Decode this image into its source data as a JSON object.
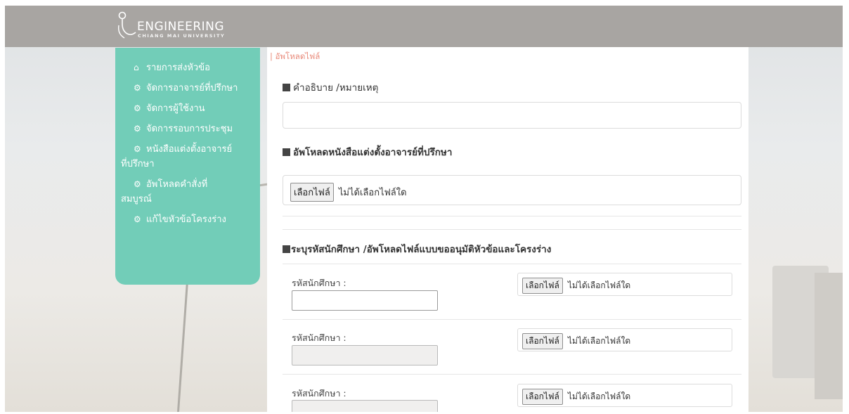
{
  "header": {
    "logo_title": "ENGINEERING",
    "logo_subtitle": "CHIANG MAI UNIVERSITY"
  },
  "sidebar": {
    "items": [
      {
        "icon": "home-icon",
        "label": "รายการส่งหัวข้อ"
      },
      {
        "icon": "gear-icon",
        "label": "จัดการอาจารย์ที่ปรึกษา"
      },
      {
        "icon": "gear-icon",
        "label": "จัดการผู้ใช้งาน"
      },
      {
        "icon": "gear-icon",
        "label": "จัดการรอบการประชุม"
      },
      {
        "icon": "gear-icon",
        "label": "หนังสือแต่งตั้งอาจารย์",
        "label2": "ที่ปรึกษา"
      },
      {
        "icon": "gear-icon",
        "label": "อัพโหลดคำสั่งที่",
        "label2": "สมบูรณ์"
      },
      {
        "icon": "gear-icon",
        "label": "แก้ไขหัวข้อโครงร่าง"
      }
    ]
  },
  "main": {
    "breadcrumb": "| อัพโหลดไฟล์",
    "description_title": "คำอธิบาย /หมายเหตุ",
    "description_value": "",
    "upload_appointment_title": "อัพโหลดหนังสือแต่งตั้งอาจารย์ที่ปรึกษา",
    "file_button": "เลือกไฟล์",
    "file_none": "ไม่ได้เลือกไฟล์ใด",
    "student_section_title": "ระบุรหัสนักศึกษา /อัพโหลดไฟล์แบบขออนุมัติหัวข้อและโครงร่าง",
    "student_rows": [
      {
        "label": "รหัสนักศึกษา :",
        "value": "",
        "disabled": false
      },
      {
        "label": "รหัสนักศึกษา :",
        "value": "",
        "disabled": true
      },
      {
        "label": "รหัสนักศึกษา :",
        "value": "",
        "disabled": true
      }
    ]
  },
  "colors": {
    "topbar": "#a8a5a2",
    "sidebar": "#72cdb8",
    "breadcrumb": "#e98a7a"
  }
}
